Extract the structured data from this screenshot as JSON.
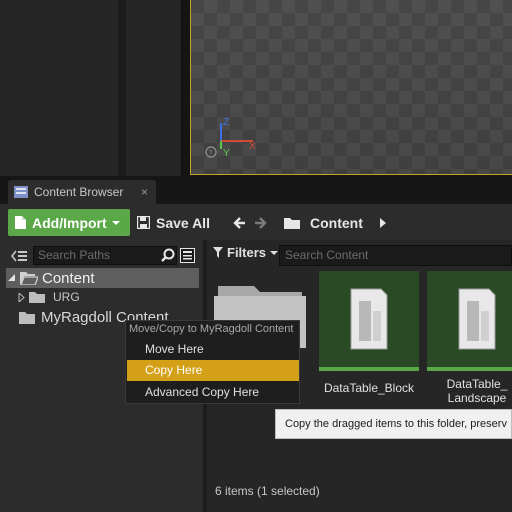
{
  "tab": {
    "title": "Content Browser",
    "close": "×"
  },
  "toolbar": {
    "add_import_label": "Add/Import",
    "save_all_label": "Save All",
    "path_root": "Content"
  },
  "sources": {
    "search_placeholder": "Search Paths",
    "tree": [
      {
        "label": "Content",
        "expanded": true,
        "selected": true
      },
      {
        "label": "URG",
        "expanded": false,
        "selected": false
      },
      {
        "label": "MyRagdoll Content",
        "expanded": false,
        "selected": false
      }
    ]
  },
  "content": {
    "filters_label": "Filters",
    "search_placeholder": "Search Content",
    "assets": [
      {
        "label": "DataTable_Block"
      },
      {
        "label_line1": "DataTable_",
        "label_line2": "Landscape"
      }
    ],
    "status": "6 items (1 selected)"
  },
  "context_menu": {
    "title": "Move/Copy to MyRagdoll Content",
    "items": [
      "Move Here",
      "Copy Here",
      "Advanced Copy Here"
    ],
    "highlighted": "Copy Here"
  },
  "tooltip": "Copy the dragged items to this folder, preserv",
  "colors": {
    "accent_green": "#5aa848",
    "highlight": "#d4a017",
    "viewport_border": "#c9a227"
  }
}
